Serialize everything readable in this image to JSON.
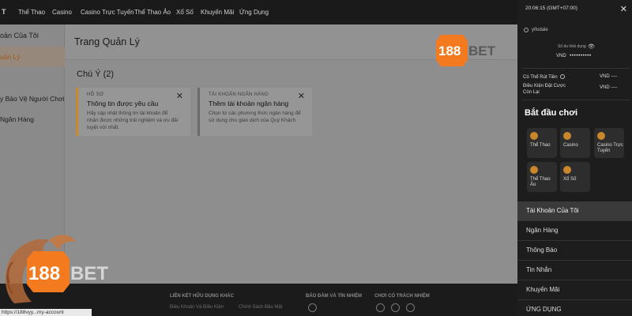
{
  "nav": {
    "brand_fragment": "T",
    "items": [
      "Thể Thao",
      "Casino",
      "Casino Trực Tuyến",
      "Thể Thao Ảo",
      "Xổ Số",
      "Khuyến Mãi",
      "Ứng Dụng"
    ]
  },
  "sidebar": {
    "title": "oản Của Tôi",
    "items": [
      {
        "label": "uản Lý",
        "active": true
      },
      {
        "label": "y Bảo Vệ Người Chơi",
        "active": false
      },
      {
        "label": "Ngân Hàng",
        "active": false
      }
    ]
  },
  "main": {
    "title": "Trang Quản Lý",
    "logo": "188BET",
    "notice_title": "Chú Ý (2)",
    "cards": [
      {
        "tag": "HỒ SƠ",
        "title": "Thông tin được yêu cầu",
        "desc": "Hãy cập nhật thông tin tài khoản để nhận được những trải nghiệm và ưu đãi tuyệt vời nhất.",
        "color": "#c98a2a"
      },
      {
        "tag": "TÀI KHOẢN NGÂN HÀNG",
        "title": "Thêm tài khoản ngân hàng",
        "desc": "Chọn từ các phương thức ngân hàng để sử dụng cho giao dịch của Quý Khách",
        "color": "#6b6b6b"
      }
    ]
  },
  "footer": {
    "col1": {
      "heading": "LIÊN KẾT HỮU DỤNG KHÁC",
      "links": [
        "Điều Khoản Và Điều Kiện",
        "Chính Sách Bảo Mật"
      ]
    },
    "col2": {
      "heading": "BẢO ĐẢM VÀ TÍN NHIỆM"
    },
    "col3": {
      "heading": "CHƠI CÓ TRÁCH NHIỆM"
    }
  },
  "overlay_logo": "188BET",
  "url_text": "https://188vyy...my-account",
  "drawer": {
    "time": "20:06:15 (GMT+07:00)",
    "username": "yifodale",
    "balance_label": "Số dư khả dụng",
    "currency": "VND",
    "balance_masked": "••••••••••",
    "rows": [
      {
        "label": "Có Thể Rút Tiền",
        "value": "VND ----"
      },
      {
        "label": "Điều Kiện Đặt Cược Còn Lại",
        "value": "VND ----"
      }
    ],
    "start_title": "Bắt đầu chơi",
    "tiles": [
      {
        "label": "Thể Thao"
      },
      {
        "label": "Casino"
      },
      {
        "label": "Casino Trực Tuyến"
      },
      {
        "label": "Thể Thao Ảo"
      },
      {
        "label": "Xổ Số"
      }
    ],
    "menu": [
      {
        "label": "Tài Khoản Của Tôi",
        "active": true
      },
      {
        "label": "Ngân Hàng",
        "active": false
      },
      {
        "label": "Thông Báo",
        "active": false
      },
      {
        "label": "Tin Nhắn",
        "active": false
      },
      {
        "label": "Khuyến Mãi",
        "active": false
      },
      {
        "label": "ỨNG DỤNG",
        "active": false
      }
    ]
  },
  "colors": {
    "accent": "#f47a20",
    "dark": "#1d1d1d",
    "overlay": "#8e8e8e"
  }
}
